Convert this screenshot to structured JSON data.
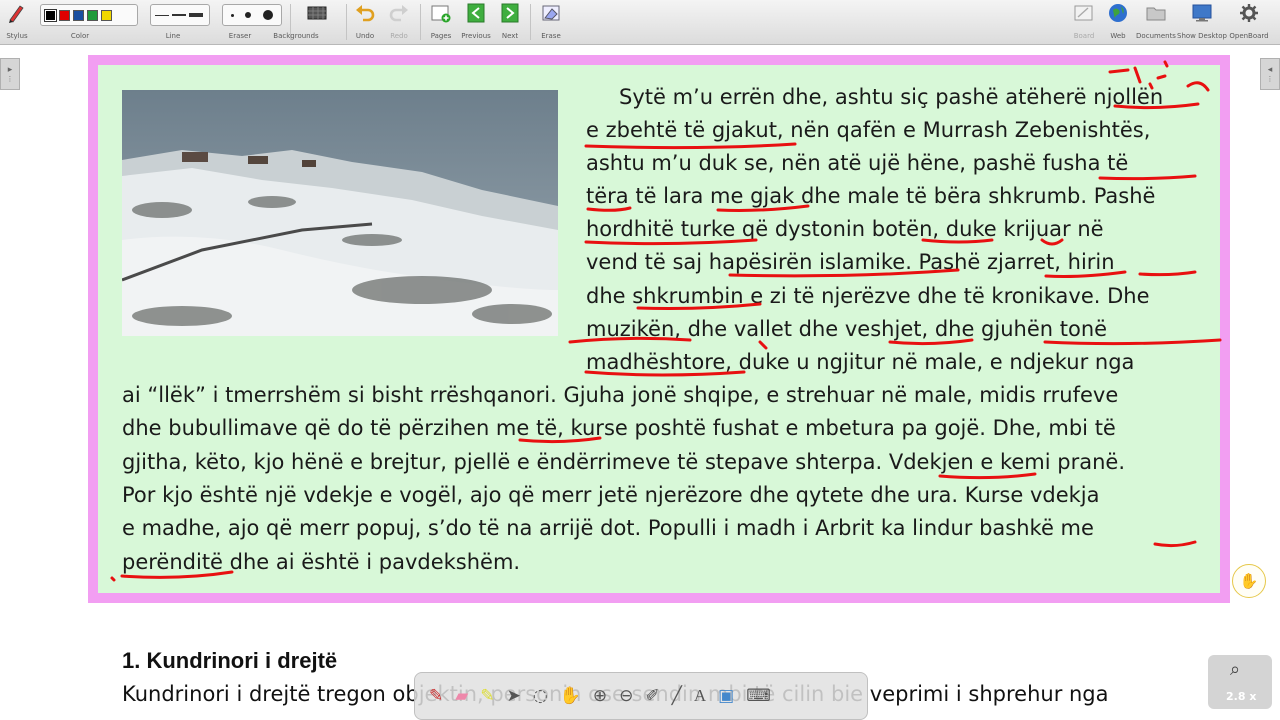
{
  "toolbar": {
    "stylus": "Stylus",
    "color": "Color",
    "line": "Line",
    "eraser": "Eraser",
    "backgrounds": "Backgrounds",
    "undo": "Undo",
    "redo": "Redo",
    "pages": "Pages",
    "previous": "Previous",
    "next": "Next",
    "erase": "Erase",
    "board": "Board",
    "web": "Web",
    "documents": "Documents",
    "show_desktop": "Show Desktop",
    "openboard": "OpenBoard",
    "colors": [
      "#000000",
      "#e00000",
      "#1a4fa0",
      "#1f9a3a",
      "#f0d800"
    ]
  },
  "passage": {
    "lines": [
      "Sytë m’u errën dhe, ashtu siç pashë atëherë njollën",
      "e zbehtë të gjakut, nën qafën e Murrash Zebenishtës,",
      "ashtu m’u duk se, nën atë ujë hëne, pashë fusha të",
      "tëra të lara me gjak dhe male të bëra shkrumb. Pashë",
      "hordhitë turke që dystonin botën, duke krijuar në",
      "vend të saj hapësirën islamike. Pashë zjarret, hirin",
      "dhe shkrumbin e zi të njerëzve dhe të kronikave. Dhe",
      "muzikën, dhe vallet dhe veshjet, dhe gjuhën tonë",
      "madhështore, duke u ngjitur në male, e ndjekur nga",
      "ai “llëk” i tmerrshëm si bisht rrëshqanori. Gjuha jonë shqipe, e strehuar në male, midis rrufeve",
      "dhe bubullimave që do të përzihen me të, kurse poshtë fushat e mbetura pa gojë. Dhe, mbi të",
      "gjitha, këto, kjo hënë e brejtur, pjellë e ëndërrimeve të stepave shterpa. Vdekjen e kemi pranë.",
      "Por kjo është një vdekje e vogël, ajo që merr jetë njerëzore dhe qytete dhe ura. Kurse vdekja",
      "e madhe, ajo që merr popuj, s’do të na arrijë dot. Populli i madh i Arbrit ka lindur bashkë me",
      "perënditë dhe ai është i pavdekshëm."
    ]
  },
  "section": {
    "heading": "1. Kundrinori i drejtë",
    "body_start": "Kundrinori i drejtë tregon objektin, personin ose sendin mbi të cilin bie veprimi i shprehur nga"
  },
  "zoom": {
    "label": "2.8 x"
  },
  "ink_color": "#e81010"
}
